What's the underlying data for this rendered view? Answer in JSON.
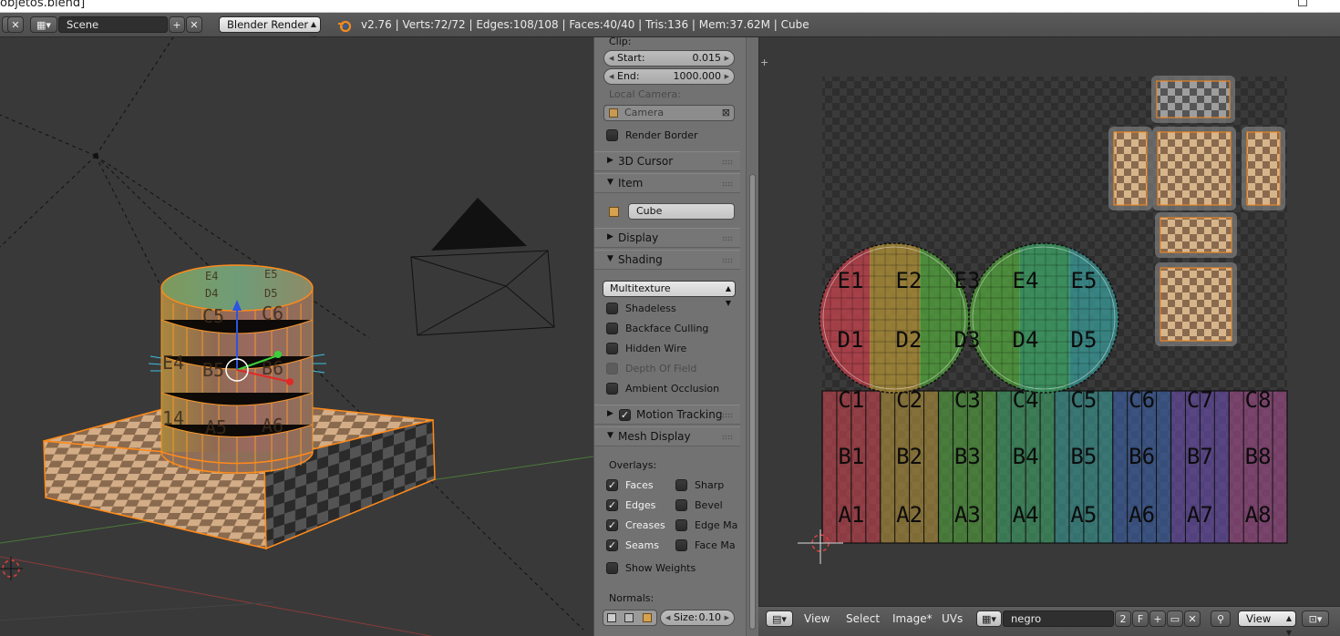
{
  "window": {
    "title": "objetos.blend]"
  },
  "header": {
    "scene_name": "Scene",
    "render_engine": "Blender Render",
    "stats": "v2.76 | Verts:72/72 | Edges:108/108 | Faces:40/40 | Tris:136 | Mem:37.62M | Cube"
  },
  "npanel": {
    "clip_label": "Clip:",
    "clip_start_label": "Start:",
    "clip_start_value": "0.015",
    "clip_end_label": "End:",
    "clip_end_value": "1000.000",
    "local_camera_label": "Local Camera:",
    "local_camera_value": "Camera",
    "render_border_label": "Render Border",
    "panels": {
      "cursor3d": "3D Cursor",
      "item": "Item",
      "display": "Display",
      "shading": "Shading",
      "motion_tracking": "Motion Tracking",
      "mesh_display": "Mesh Display"
    },
    "item_name": "Cube",
    "shading_mode": "Multitexture",
    "shading_options": [
      {
        "label": "Shadeless",
        "checked": false,
        "enabled": true
      },
      {
        "label": "Backface Culling",
        "checked": false,
        "enabled": true
      },
      {
        "label": "Hidden Wire",
        "checked": false,
        "enabled": true
      },
      {
        "label": "Depth Of Field",
        "checked": false,
        "enabled": false
      },
      {
        "label": "Ambient Occlusion",
        "checked": false,
        "enabled": true
      }
    ],
    "overlays_label": "Overlays:",
    "overlays_left": [
      {
        "label": "Faces",
        "checked": true
      },
      {
        "label": "Edges",
        "checked": true
      },
      {
        "label": "Creases",
        "checked": true
      },
      {
        "label": "Seams",
        "checked": true
      }
    ],
    "overlays_right": [
      {
        "label": "Sharp",
        "checked": false
      },
      {
        "label": "Bevel",
        "checked": false
      },
      {
        "label": "Edge Ma",
        "checked": false
      },
      {
        "label": "Face Ma",
        "checked": false
      }
    ],
    "show_weights_label": "Show Weights",
    "normals_label": "Normals:",
    "normals_size_label": "Size:",
    "normals_size_value": "0.10"
  },
  "viewport": {
    "cylinder_labels": [
      {
        "t": "E4"
      },
      {
        "t": "E5"
      },
      {
        "t": "D4"
      },
      {
        "t": "D5"
      },
      {
        "t": "C5"
      },
      {
        "t": "C6"
      },
      {
        "t": "B5"
      },
      {
        "t": "B6"
      },
      {
        "t": "A5"
      },
      {
        "t": "A6"
      },
      {
        "t": "E4"
      },
      {
        "t": "14"
      }
    ]
  },
  "uv_editor": {
    "menus": [
      "View",
      "Select",
      "Image*",
      "UVs"
    ],
    "image_name": "negro",
    "users_count": "2",
    "fake_user": "F",
    "view_label": "View",
    "circle_labels": [
      "E1",
      "E2",
      "E3",
      "E4",
      "E5",
      "D1",
      "D2",
      "D3",
      "D4",
      "D5"
    ],
    "rows": {
      "C": [
        "C1",
        "C2",
        "C3",
        "C4",
        "C5",
        "C6",
        "C7",
        "C8"
      ],
      "B": [
        "B1",
        "B2",
        "B3",
        "B4",
        "B5",
        "B6",
        "B7",
        "B8"
      ],
      "A": [
        "A1",
        "A2",
        "A3",
        "A4",
        "A5",
        "A6",
        "A7",
        "A8"
      ]
    },
    "palette": [
      "#c9444f",
      "#b5953a",
      "#55a83f",
      "#3fa86a",
      "#3a9e9b",
      "#3e64ad",
      "#6a4fb0",
      "#a54d8e"
    ]
  }
}
